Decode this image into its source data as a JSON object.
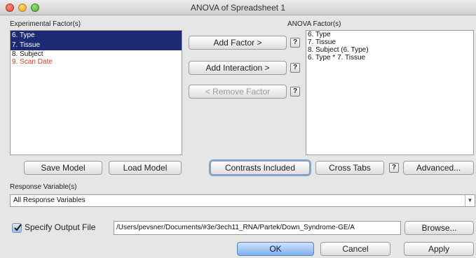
{
  "window": {
    "title": "ANOVA of Spreadsheet 1"
  },
  "experimental_factors": {
    "label": "Experimental Factor(s)",
    "items": [
      {
        "label": "6. Type",
        "selected": true
      },
      {
        "label": "7. Tissue",
        "selected": true
      },
      {
        "label": "8. Subject",
        "selected": false
      },
      {
        "label": "9. Scan Date",
        "selected": false,
        "color": "#e03a2a"
      }
    ]
  },
  "actions": {
    "add_factor": "Add Factor >",
    "add_interaction": "Add Interaction >",
    "remove_factor": "< Remove Factor",
    "help_glyph": "?"
  },
  "anova_factors": {
    "label": "ANOVA Factor(s)",
    "items": [
      "6. Type",
      "7. Tissue",
      "8. Subject (6. Type)",
      "6. Type * 7. Tissue"
    ]
  },
  "model_buttons": {
    "save_model": "Save Model",
    "load_model": "Load Model",
    "contrasts": "Contrasts Included",
    "cross_tabs": "Cross Tabs",
    "advanced": "Advanced..."
  },
  "response": {
    "label": "Response Variable(s)",
    "value": "All Response Variables"
  },
  "output": {
    "checkbox_label": "Specify Output File",
    "checked": true,
    "path": "/Users/pevsner/Documents/#3e/3ech11_RNA/Partek/Down_Syndrome-GE/A",
    "browse": "Browse..."
  },
  "footer": {
    "ok": "OK",
    "cancel": "Cancel",
    "apply": "Apply"
  }
}
